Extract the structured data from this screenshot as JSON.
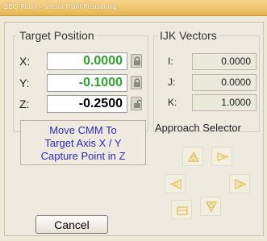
{
  "window": {
    "title": "GEO-Plus© - Vector Point Positioning"
  },
  "target": {
    "label": "Target Position",
    "rows": [
      {
        "axis": "X:",
        "value": "0.0000",
        "color": "#2aa52a"
      },
      {
        "axis": "Y:",
        "value": "-0.1000",
        "color": "#2aa52a"
      },
      {
        "axis": "Z:",
        "value": "-0.2500",
        "color": "#000000"
      }
    ]
  },
  "ijk": {
    "label": "IJK Vectors",
    "rows": [
      {
        "axis": "I:",
        "value": "0.0000"
      },
      {
        "axis": "J:",
        "value": "0.0000"
      },
      {
        "axis": "K:",
        "value": "1.0000"
      }
    ]
  },
  "instructions": {
    "lines": [
      "Move CMM To",
      "Target Axis X / Y",
      "Capture Point in Z"
    ]
  },
  "approach": {
    "label": "Approach Selector"
  },
  "buttons": {
    "cancel": "Cancel"
  }
}
